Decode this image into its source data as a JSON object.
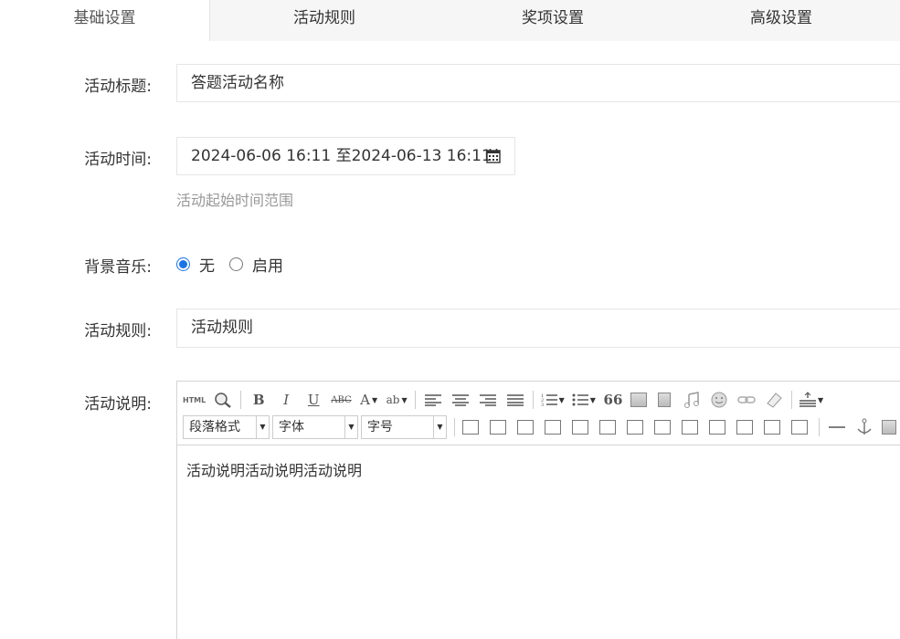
{
  "tabs": [
    {
      "label": "基础设置"
    },
    {
      "label": "活动规则"
    },
    {
      "label": "奖项设置"
    },
    {
      "label": "高级设置"
    }
  ],
  "form": {
    "title_label": "活动标题:",
    "title_value": "答题活动名称",
    "time_label": "活动时间:",
    "time_value": "2024-06-06 16:11 至2024-06-13 16:11",
    "time_hint": "活动起始时间范围",
    "music_label": "背景音乐:",
    "music_options": [
      "无",
      "启用"
    ],
    "music_selected": "无",
    "rules_label": "活动规则:",
    "rules_value": "活动规则",
    "desc_label": "活动说明:"
  },
  "editor": {
    "toolbar": {
      "html_btn": "HTML",
      "bold": "B",
      "italic": "I",
      "underline": "U",
      "strike": "ABC",
      "font_color": "A",
      "highlight": "ab",
      "quote": "66",
      "paragraph_select": "段落格式",
      "font_select": "字体",
      "size_select": "字号"
    },
    "content": "活动说明活动说明活动说明"
  },
  "colors": {
    "accent": "#1a73e8",
    "border": "#e6e6e6",
    "tab_bg": "#f6f6f6",
    "hint": "#999999"
  }
}
